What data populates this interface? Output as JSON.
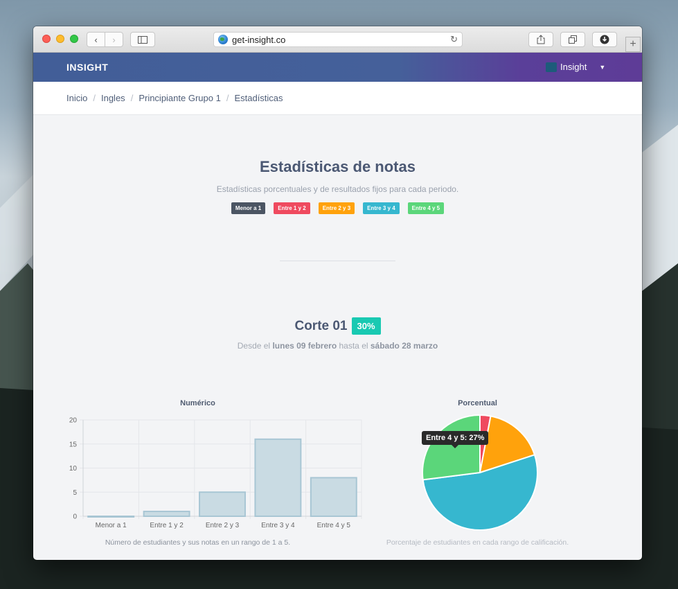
{
  "browser": {
    "url": "get-insight.co"
  },
  "app": {
    "brand": "INSIGHT",
    "user_menu_label": "Insight"
  },
  "breadcrumb": {
    "items": [
      "Inicio",
      "Ingles",
      "Principiante Grupo 1"
    ],
    "current": "Estadísticas"
  },
  "header": {
    "title": "Estadísticas de notas",
    "subtitle": "Estadísticas porcentuales y de resultados fijos para cada periodo."
  },
  "legend": [
    {
      "label": "Menor a 1",
      "color": "#4b5563"
    },
    {
      "label": "Entre 1 y 2",
      "color": "#ef4a5f"
    },
    {
      "label": "Entre 2 y 3",
      "color": "#ffa20c"
    },
    {
      "label": "Entre 3 y 4",
      "color": "#36b7cf"
    },
    {
      "label": "Entre 4 y 5",
      "color": "#5bd67a"
    }
  ],
  "corte": {
    "title": "Corte 01",
    "percent": "30%",
    "dates_prefix": "Desde el",
    "start": "lunes 09 febrero",
    "dates_mid": "hasta el",
    "end": "sábado 28 marzo"
  },
  "numeric_chart": {
    "title": "Numérico",
    "caption": "Número de estudiantes y sus notas en un rango de 1 a 5."
  },
  "percent_chart": {
    "title": "Porcentual",
    "caption": "Porcentaje de estudiantes en cada rango de calificación.",
    "tooltip": "Entre 4 y 5: 27%"
  },
  "chart_data": [
    {
      "type": "bar",
      "title": "Numérico",
      "categories": [
        "Menor a 1",
        "Entre 1 y 2",
        "Entre 2 y 3",
        "Entre 3 y 4",
        "Entre 4 y 5"
      ],
      "values": [
        0,
        1,
        5,
        16,
        8
      ],
      "yticks": [
        0,
        5,
        10,
        15,
        20
      ],
      "ylim": [
        0,
        20
      ],
      "bar_color": "#c9dbe3",
      "bar_border": "#a8c6d4"
    },
    {
      "type": "pie",
      "title": "Porcentual",
      "categories": [
        "Menor a 1",
        "Entre 1 y 2",
        "Entre 2 y 3",
        "Entre 3 y 4",
        "Entre 4 y 5"
      ],
      "values": [
        0,
        3,
        17,
        53,
        27
      ],
      "colors": [
        "#4b5563",
        "#ef4a5f",
        "#ffa20c",
        "#36b7cf",
        "#5bd67a"
      ]
    }
  ]
}
